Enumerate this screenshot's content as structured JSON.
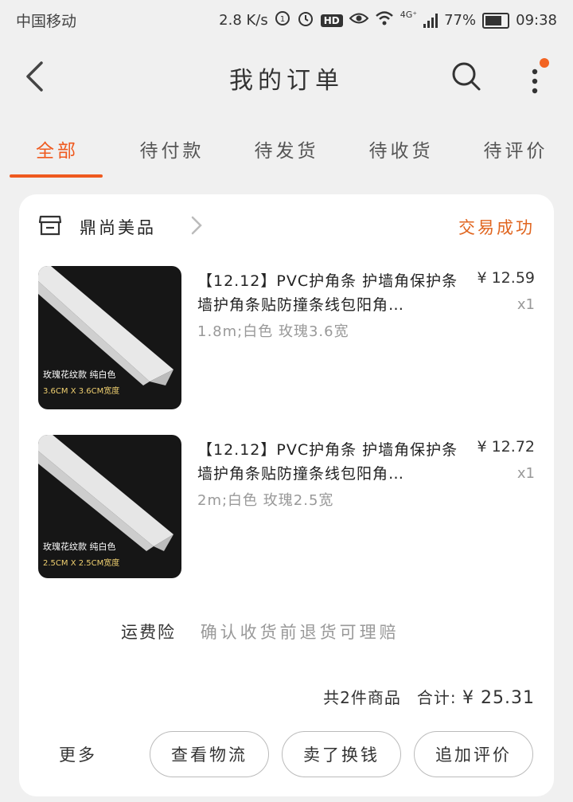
{
  "status_bar": {
    "carrier": "中国移动",
    "speed": "2.8 K/s",
    "hd_badge": "HD",
    "network_label": "4G⁺",
    "battery": "77%",
    "time": "09:38"
  },
  "header": {
    "title": "我的订单"
  },
  "tabs": [
    {
      "label": "全部",
      "active": true
    },
    {
      "label": "待付款",
      "active": false
    },
    {
      "label": "待发货",
      "active": false
    },
    {
      "label": "待收货",
      "active": false
    },
    {
      "label": "待评价",
      "active": false
    }
  ],
  "order": {
    "shop_name": "鼎尚美品",
    "status": "交易成功",
    "items": [
      {
        "title": "【12.12】PVC护角条 护墙角保护条墙护角条贴防撞条线包阳角…",
        "spec": "1.8m;白色 玫瑰3.6宽",
        "price": "¥ 12.59",
        "qty": "x1",
        "thumb_caption": "玫瑰花纹款  纯白色",
        "thumb_sub": "3.6CM X 3.6CM宽度"
      },
      {
        "title": "【12.12】PVC护角条 护墙角保护条墙护角条贴防撞条线包阳角…",
        "spec": "2m;白色 玫瑰2.5宽",
        "price": "¥ 12.72",
        "qty": "x1",
        "thumb_caption": "玫瑰花纹款  纯白色",
        "thumb_sub": "2.5CM X 2.5CM宽度"
      }
    ],
    "insurance_label": "运费险",
    "insurance_text": "确认收货前退货可理赔",
    "total_count": "共2件商品",
    "total_label": "合计:",
    "total_amount": "¥ 25.31",
    "more": "更多",
    "buttons": {
      "logistics": "查看物流",
      "sell": "卖了换钱",
      "review": "追加评价"
    }
  },
  "colors": {
    "accent": "#ef5a1f",
    "status": "#e0651f",
    "notification_dot": "#f26322"
  }
}
